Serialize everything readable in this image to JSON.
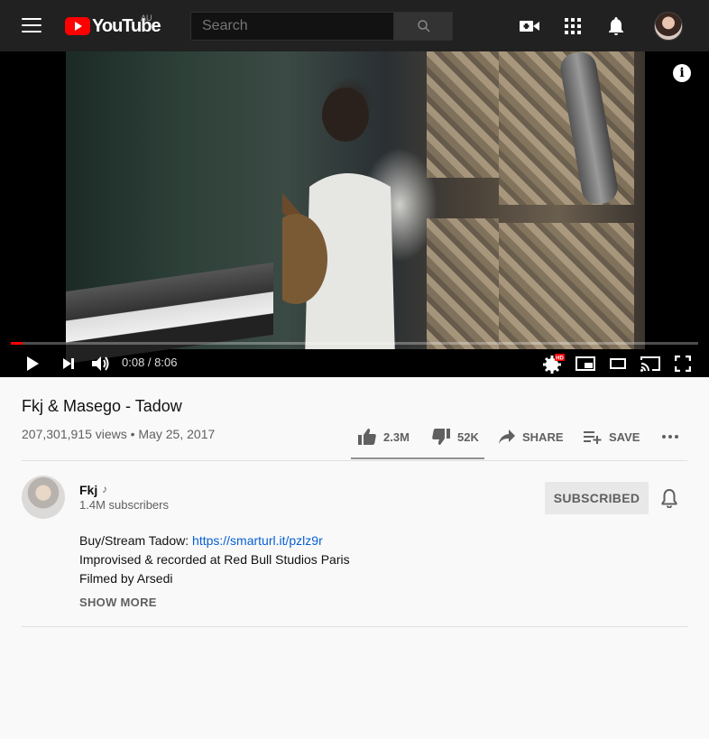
{
  "header": {
    "logo_text": "YouTube",
    "region": "AU",
    "search_placeholder": "Search",
    "icons": [
      "menu-icon",
      "search-icon",
      "create-video-icon",
      "apps-icon",
      "notifications-icon",
      "account-avatar"
    ]
  },
  "player": {
    "current_time": "0:08",
    "duration": "8:06",
    "time_display": "0:08 / 8:06",
    "progress_fraction": 0.017,
    "quality_badge": "HD",
    "info_label": "i"
  },
  "video": {
    "title": "Fkj & Masego - Tadow",
    "meta": "207,301,915 views • May 25, 2017",
    "likes": "2.3M",
    "dislikes": "52K",
    "share_label": "SHARE",
    "save_label": "SAVE",
    "like_ratio": 0.978
  },
  "channel": {
    "name": "Fkj",
    "note": "♪",
    "subscribers": "1.4M subscribers",
    "subscribe_label": "SUBSCRIBED"
  },
  "description": {
    "line1_prefix": "Buy/Stream Tadow: ",
    "line1_link": "https://smarturl.it/pzlz9r",
    "line2": "Improvised & recorded at Red Bull Studios Paris",
    "line3": "Filmed by Arsedi",
    "show_more": "SHOW MORE"
  },
  "colors": {
    "topbar_bg": "#212121",
    "brand_red": "#ff0000",
    "link_blue": "#065fd4",
    "page_bg": "#f9f9f9"
  }
}
